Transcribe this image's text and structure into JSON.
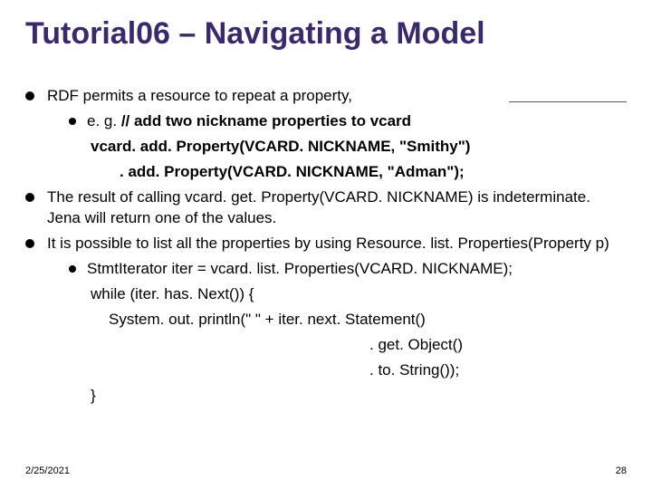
{
  "title": "Tutorial06 – Navigating a Model",
  "bullets": {
    "b1": "RDF permits a resource to repeat a property,",
    "b1a_lead": "e. g. ",
    "b1a_rest": "// add two nickname properties to vcard",
    "b1a_line2": "vcard. add. Property(VCARD. NICKNAME, \"Smithy\")",
    "b1a_line3": ". add. Property(VCARD. NICKNAME, \"Adman\");",
    "b2": "The result of calling vcard. get. Property(VCARD. NICKNAME) is indeterminate. Jena will return one of the values.",
    "b3": "It is possible to list all the properties by using Resource. list. Properties(Property p)",
    "b3a": "StmtIterator iter = vcard. list. Properties(VCARD. NICKNAME);",
    "b3a_l2": "while (iter. has. Next()) {",
    "b3a_l3": "System. out. println(\" \" + iter. next. Statement()",
    "b3a_l4": ". get. Object()",
    "b3a_l5": ". to. String());",
    "b3a_l6": "}"
  },
  "footer": {
    "date": "2/25/2021",
    "page": "28"
  }
}
